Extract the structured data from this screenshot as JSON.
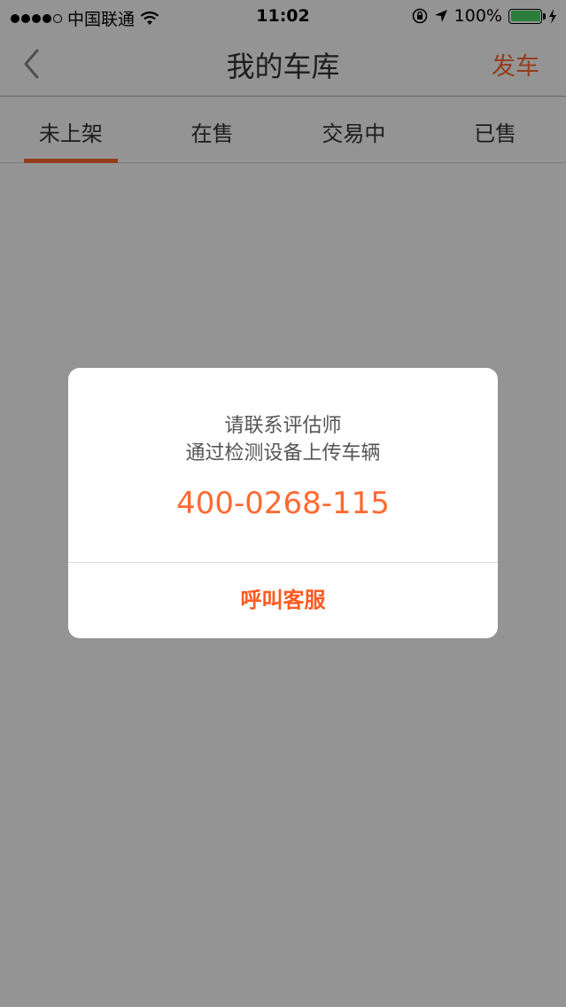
{
  "status_bar": {
    "carrier": "中国联通",
    "time": "11:02",
    "battery": "100%"
  },
  "nav": {
    "title": "我的车库",
    "action": "发车"
  },
  "tabs": [
    {
      "label": "未上架",
      "active": true
    },
    {
      "label": "在售",
      "active": false
    },
    {
      "label": "交易中",
      "active": false
    },
    {
      "label": "已售",
      "active": false
    }
  ],
  "dialog": {
    "message_line1": "请联系评估师",
    "message_line2": "通过检测设备上传车辆",
    "phone": "400-0268-115",
    "button": "呼叫客服"
  },
  "colors": {
    "accent": "#ff6a33",
    "battery": "#4cd964",
    "overlay": "rgba(0,0,0,0.42)"
  }
}
